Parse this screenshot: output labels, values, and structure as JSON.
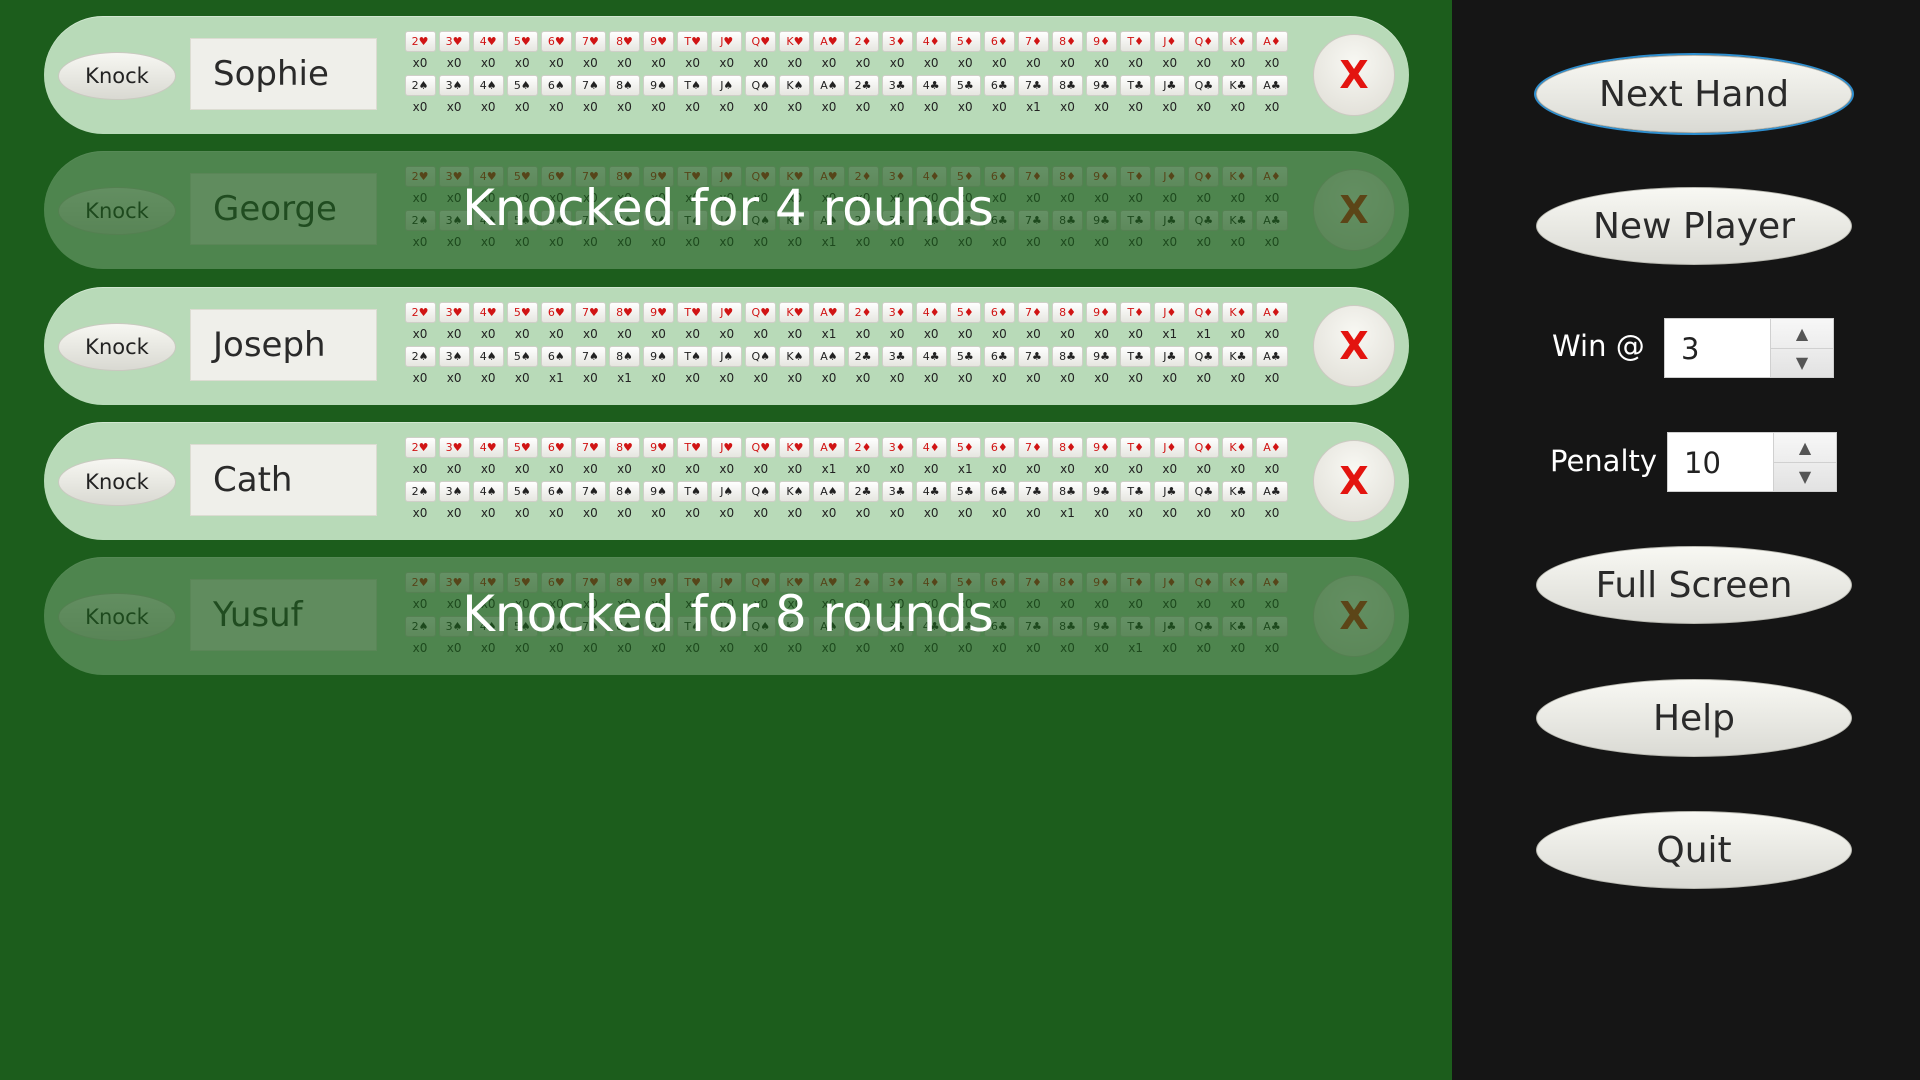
{
  "labels": {
    "knock_button": "Knock",
    "remove_button": "X"
  },
  "card_row_1": [
    "2♥",
    "3♥",
    "4♥",
    "5♥",
    "6♥",
    "7♥",
    "8♥",
    "9♥",
    "T♥",
    "J♥",
    "Q♥",
    "K♥",
    "A♥",
    "2♦",
    "3♦",
    "4♦",
    "5♦",
    "6♦",
    "7♦",
    "8♦",
    "9♦",
    "T♦",
    "J♦",
    "Q♦",
    "K♦",
    "A♦"
  ],
  "card_row_2": [
    "2♠",
    "3♠",
    "4♠",
    "5♠",
    "6♠",
    "7♠",
    "8♠",
    "9♠",
    "T♠",
    "J♠",
    "Q♠",
    "K♠",
    "A♠",
    "2♣",
    "3♣",
    "4♣",
    "5♣",
    "6♣",
    "7♣",
    "8♣",
    "9♣",
    "T♣",
    "J♣",
    "Q♣",
    "K♣",
    "A♣"
  ],
  "players": [
    {
      "name": "Sophie",
      "knocked": false,
      "status": "",
      "counts_1": [
        "x0",
        "x0",
        "x0",
        "x0",
        "x0",
        "x0",
        "x0",
        "x0",
        "x0",
        "x0",
        "x0",
        "x0",
        "x0",
        "x0",
        "x0",
        "x0",
        "x0",
        "x0",
        "x0",
        "x0",
        "x0",
        "x0",
        "x0",
        "x0",
        "x0",
        "x0"
      ],
      "counts_2": [
        "x0",
        "x0",
        "x0",
        "x0",
        "x0",
        "x0",
        "x0",
        "x0",
        "x0",
        "x0",
        "x0",
        "x0",
        "x0",
        "x0",
        "x0",
        "x0",
        "x0",
        "x0",
        "x1",
        "x0",
        "x0",
        "x0",
        "x0",
        "x0",
        "x0",
        "x0"
      ]
    },
    {
      "name": "George",
      "knocked": true,
      "status": "Knocked for 4 rounds",
      "counts_1": [
        "x0",
        "x0",
        "x0",
        "x0",
        "x0",
        "x0",
        "x0",
        "x0",
        "x0",
        "x0",
        "x0",
        "x0",
        "x0",
        "x0",
        "x0",
        "x0",
        "x0",
        "x0",
        "x0",
        "x0",
        "x0",
        "x0",
        "x0",
        "x0",
        "x0",
        "x0"
      ],
      "counts_2": [
        "x0",
        "x0",
        "x0",
        "x0",
        "x0",
        "x0",
        "x0",
        "x0",
        "x0",
        "x0",
        "x0",
        "x0",
        "x1",
        "x0",
        "x0",
        "x0",
        "x0",
        "x0",
        "x0",
        "x0",
        "x0",
        "x0",
        "x0",
        "x0",
        "x0",
        "x0"
      ]
    },
    {
      "name": "Joseph",
      "knocked": false,
      "status": "",
      "counts_1": [
        "x0",
        "x0",
        "x0",
        "x0",
        "x0",
        "x0",
        "x0",
        "x0",
        "x0",
        "x0",
        "x0",
        "x0",
        "x1",
        "x0",
        "x0",
        "x0",
        "x0",
        "x0",
        "x0",
        "x0",
        "x0",
        "x0",
        "x1",
        "x1",
        "x0",
        "x0"
      ],
      "counts_2": [
        "x0",
        "x0",
        "x0",
        "x0",
        "x1",
        "x0",
        "x1",
        "x0",
        "x0",
        "x0",
        "x0",
        "x0",
        "x0",
        "x0",
        "x0",
        "x0",
        "x0",
        "x0",
        "x0",
        "x0",
        "x0",
        "x0",
        "x0",
        "x0",
        "x0",
        "x0"
      ]
    },
    {
      "name": "Cath",
      "knocked": false,
      "status": "",
      "counts_1": [
        "x0",
        "x0",
        "x0",
        "x0",
        "x0",
        "x0",
        "x0",
        "x0",
        "x0",
        "x0",
        "x0",
        "x0",
        "x1",
        "x0",
        "x0",
        "x0",
        "x1",
        "x0",
        "x0",
        "x0",
        "x0",
        "x0",
        "x0",
        "x0",
        "x0",
        "x0"
      ],
      "counts_2": [
        "x0",
        "x0",
        "x0",
        "x0",
        "x0",
        "x0",
        "x0",
        "x0",
        "x0",
        "x0",
        "x0",
        "x0",
        "x0",
        "x0",
        "x0",
        "x0",
        "x0",
        "x0",
        "x0",
        "x1",
        "x0",
        "x0",
        "x0",
        "x0",
        "x0",
        "x0"
      ]
    },
    {
      "name": "Yusuf",
      "knocked": true,
      "status": "Knocked for 8 rounds",
      "counts_1": [
        "x0",
        "x0",
        "x0",
        "x0",
        "x0",
        "x0",
        "x0",
        "x0",
        "x0",
        "x0",
        "x0",
        "x0",
        "x0",
        "x0",
        "x0",
        "x0",
        "x0",
        "x0",
        "x0",
        "x0",
        "x0",
        "x0",
        "x0",
        "x0",
        "x0",
        "x0"
      ],
      "counts_2": [
        "x0",
        "x0",
        "x0",
        "x0",
        "x0",
        "x0",
        "x0",
        "x0",
        "x0",
        "x0",
        "x0",
        "x0",
        "x0",
        "x0",
        "x0",
        "x0",
        "x0",
        "x0",
        "x0",
        "x0",
        "x0",
        "x1",
        "x0",
        "x0",
        "x0",
        "x0"
      ]
    }
  ],
  "sidebar": {
    "next_hand": "Next Hand",
    "new_player": "New Player",
    "win_label": "Win @",
    "win_value": "3",
    "penalty_label": "Penalty",
    "penalty_value": "10",
    "full_screen": "Full Screen",
    "help": "Help",
    "quit": "Quit"
  },
  "colors": {
    "table_green": "#1c5d1c",
    "row_green": "#b8dab8",
    "sidebar_dark": "#151515",
    "remove_red": "#e3140f",
    "heart_red": "#d01414"
  }
}
